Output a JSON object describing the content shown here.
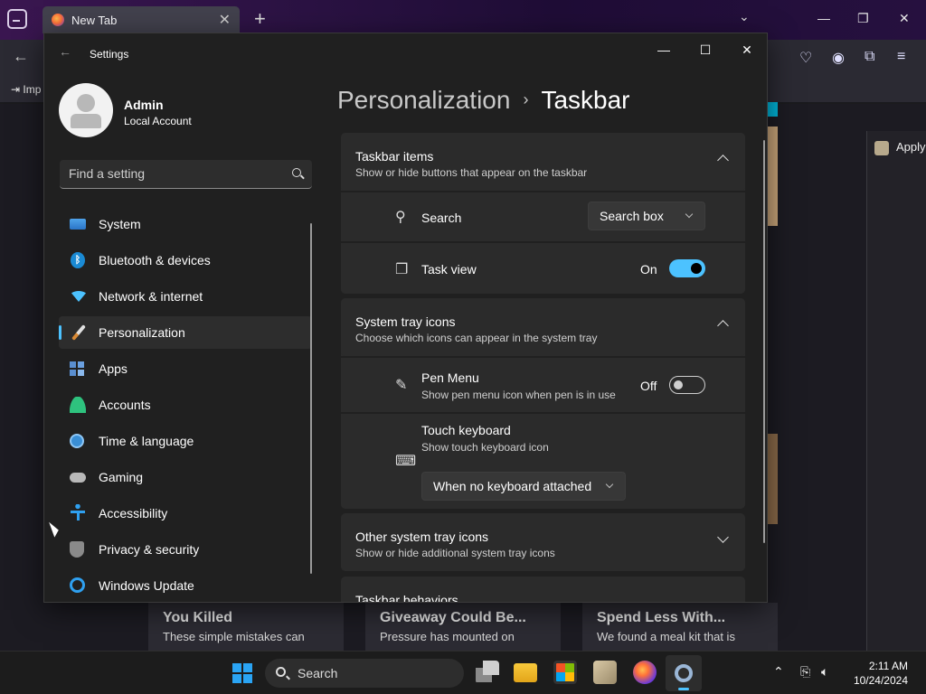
{
  "browser": {
    "tab_title": "New Tab",
    "tab_close": "✕",
    "new_tab": "+",
    "list_tabs": "⌄",
    "bookmark_label": "Imp",
    "side_panel_label": "Apply",
    "win_minimize": "—",
    "win_restore": "❐",
    "win_close": "✕",
    "back": "←",
    "toolbar_icons": [
      "pocket-icon",
      "account-icon",
      "extensions-icon",
      "menu-icon"
    ],
    "news_cards": [
      {
        "title": "You Killed",
        "desc": "These simple mistakes can"
      },
      {
        "title": "Giveaway Could Be...",
        "desc": "Pressure has mounted on"
      },
      {
        "title": "Spend Less With...",
        "desc": "We found a meal kit that is"
      }
    ]
  },
  "settings": {
    "app_title": "Settings",
    "back_arrow": "←",
    "win_minimize": "—",
    "win_maximize": "☐",
    "win_close": "✕",
    "profile": {
      "name": "Admin",
      "type": "Local Account"
    },
    "search_placeholder": "Find a setting",
    "nav": [
      {
        "label": "System",
        "icon": "system-icon"
      },
      {
        "label": "Bluetooth & devices",
        "icon": "bluetooth-icon"
      },
      {
        "label": "Network & internet",
        "icon": "wifi-icon"
      },
      {
        "label": "Personalization",
        "icon": "brush-icon",
        "active": true
      },
      {
        "label": "Apps",
        "icon": "apps-icon"
      },
      {
        "label": "Accounts",
        "icon": "accounts-icon"
      },
      {
        "label": "Time & language",
        "icon": "clock-globe-icon"
      },
      {
        "label": "Gaming",
        "icon": "controller-icon"
      },
      {
        "label": "Accessibility",
        "icon": "accessibility-icon"
      },
      {
        "label": "Privacy & security",
        "icon": "shield-icon"
      },
      {
        "label": "Windows Update",
        "icon": "update-icon"
      }
    ],
    "breadcrumb": {
      "parent": "Personalization",
      "separator": "›",
      "current": "Taskbar"
    },
    "taskbar_items": {
      "title": "Taskbar items",
      "subtitle": "Show or hide buttons that appear on the taskbar",
      "search": {
        "label": "Search",
        "value": "Search box"
      },
      "task_view": {
        "label": "Task view",
        "state": "On"
      }
    },
    "system_tray": {
      "title": "System tray icons",
      "subtitle": "Choose which icons can appear in the system tray",
      "pen_menu": {
        "label": "Pen Menu",
        "desc": "Show pen menu icon when pen is in use",
        "state": "Off"
      },
      "touch_keyboard": {
        "label": "Touch keyboard",
        "desc": "Show touch keyboard icon",
        "value": "When no keyboard attached"
      }
    },
    "other_tray": {
      "title": "Other system tray icons",
      "subtitle": "Show or hide additional system tray icons"
    },
    "behaviors": {
      "title": "Taskbar behaviors"
    }
  },
  "taskbar": {
    "search_label": "Search",
    "time": "2:11 AM",
    "date": "10/24/2024",
    "tray_chevron": "⌃",
    "accent": "#4cc2ff"
  }
}
